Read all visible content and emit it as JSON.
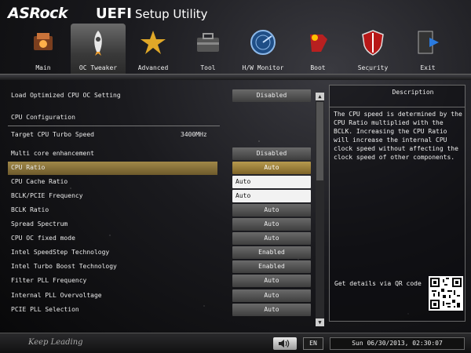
{
  "header": {
    "brand": "ASRock",
    "uefi": "UEFI",
    "subtitle": "Setup Utility"
  },
  "nav": {
    "items": [
      {
        "label": "Main",
        "icon": "main-icon"
      },
      {
        "label": "OC Tweaker",
        "icon": "rocket-icon",
        "active": true
      },
      {
        "label": "Advanced",
        "icon": "star-icon"
      },
      {
        "label": "Tool",
        "icon": "toolbox-icon"
      },
      {
        "label": "H/W Monitor",
        "icon": "radar-icon"
      },
      {
        "label": "Boot",
        "icon": "boot-icon"
      },
      {
        "label": "Security",
        "icon": "shield-icon"
      },
      {
        "label": "Exit",
        "icon": "exit-icon"
      }
    ]
  },
  "settings": {
    "load_optimized": {
      "label": "Load Optimized CPU OC Setting",
      "value": "Disabled"
    },
    "cpu_config_title": "CPU Configuration",
    "target_turbo": {
      "label": "Target CPU Turbo Speed",
      "value": "3400MHz"
    },
    "rows": [
      {
        "label": "Multi core enhancement",
        "value": "Disabled"
      },
      {
        "label": "CPU Ratio",
        "value": "Auto"
      },
      {
        "label": "CPU Cache Ratio",
        "value": "Auto"
      },
      {
        "label": "BCLK/PCIE Frequency",
        "value": "Auto"
      },
      {
        "label": "BCLK Ratio",
        "value": "Auto"
      },
      {
        "label": "Spread Spectrum",
        "value": "Auto"
      },
      {
        "label": "CPU OC fixed mode",
        "value": "Auto"
      },
      {
        "label": "Intel SpeedStep Technology",
        "value": "Enabled"
      },
      {
        "label": "Intel Turbo Boost Technology",
        "value": "Enabled"
      },
      {
        "label": "Filter PLL Frequency",
        "value": "Auto"
      },
      {
        "label": "Internal PLL Overvoltage",
        "value": "Auto"
      },
      {
        "label": "PCIE PLL Selection",
        "value": "Auto"
      }
    ]
  },
  "description": {
    "title": "Description",
    "text": "The CPU speed is determined by the CPU Ratio multiplied with the BCLK. Increasing the CPU Ratio will increase the internal CPU clock speed without affecting the clock speed of other components.",
    "qr_label": "Get details via QR code"
  },
  "footer": {
    "tagline": "Keep Leading",
    "language": "EN",
    "datetime": "Sun 06/30/2013, 02:30:07"
  },
  "colors": {
    "highlight": "#9a8044",
    "accent": "#b79a4e"
  }
}
